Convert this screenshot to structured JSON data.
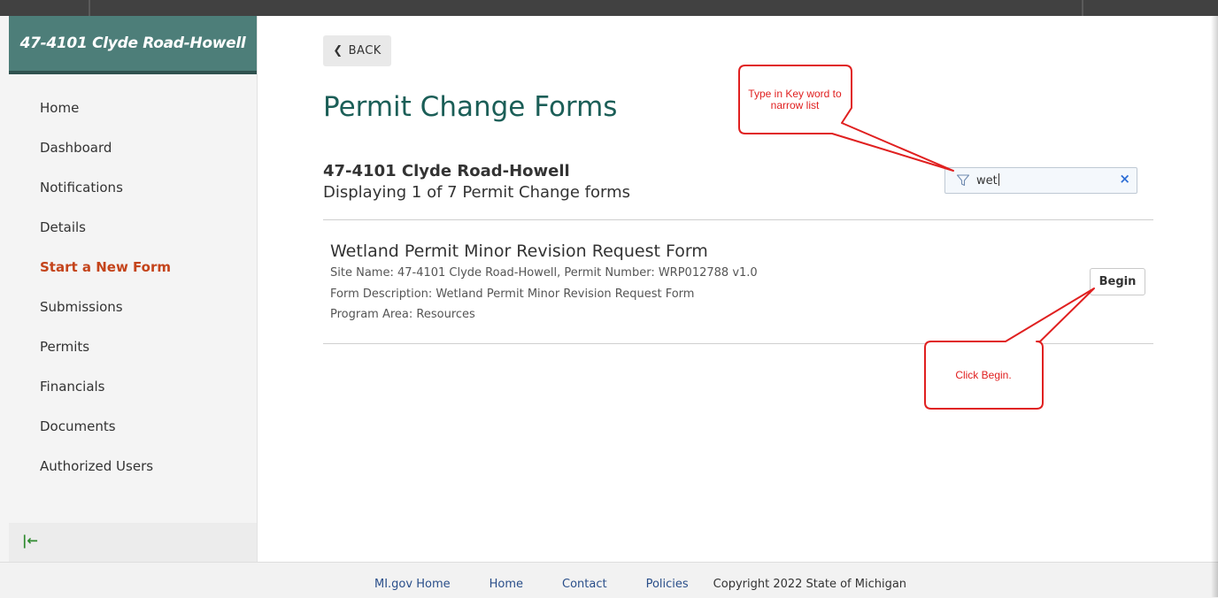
{
  "sidebar": {
    "site_title": "47-4101 Clyde Road-Howell",
    "items": [
      {
        "label": "Home"
      },
      {
        "label": "Dashboard"
      },
      {
        "label": "Notifications"
      },
      {
        "label": "Details"
      },
      {
        "label": "Start a New Form",
        "active": true
      },
      {
        "label": "Submissions"
      },
      {
        "label": "Permits"
      },
      {
        "label": "Financials"
      },
      {
        "label": "Documents"
      },
      {
        "label": "Authorized Users"
      }
    ],
    "collapse_icon": "collapse-left-icon"
  },
  "main": {
    "back_label": "BACK",
    "page_title": "Permit Change Forms",
    "site_name": "47-4101 Clyde Road-Howell",
    "display_count": "Displaying 1 of 7 Permit Change forms",
    "filter": {
      "value": "wet",
      "icon": "filter-icon",
      "clear_icon": "close-icon"
    },
    "forms": [
      {
        "title": "Wetland Permit Minor Revision Request Form",
        "site_line": "Site Name: 47-4101 Clyde Road-Howell, Permit Number: WRP012788 v1.0",
        "description_line": "Form Description: Wetland Permit Minor Revision Request Form",
        "program_line": "Program Area: Resources",
        "begin_label": "Begin"
      }
    ]
  },
  "annotations": {
    "filter_callout": "Type in Key word to narrow list",
    "begin_callout": "Click Begin.",
    "callout_color": "#e02020"
  },
  "footer": {
    "links": [
      "MI.gov Home",
      "Home",
      "Contact",
      "Policies"
    ],
    "copyright": "Copyright 2022 State of Michigan"
  },
  "colors": {
    "header_bg": "#4d7e79",
    "title": "#1b5e57",
    "active_nav": "#c4441b",
    "footer_link": "#2a4f8a"
  }
}
